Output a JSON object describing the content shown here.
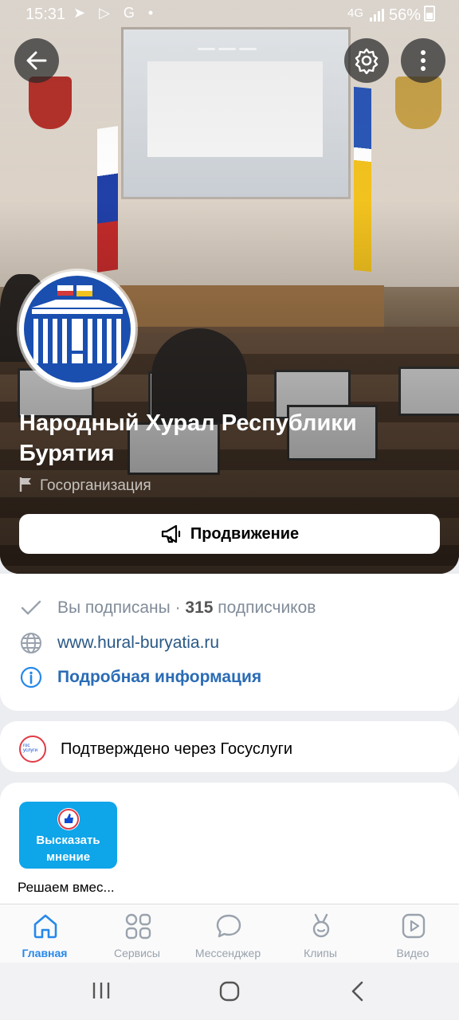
{
  "status_bar": {
    "time": "15:31",
    "left_icons": "➤ ▷ G •",
    "network": "4G",
    "battery": "56%"
  },
  "header": {
    "back_icon": "arrow-left-icon",
    "settings_icon": "gear-icon",
    "more_icon": "vertical-dots-icon"
  },
  "community": {
    "name": "Народный Хурал Республики Бурятия",
    "type": "Госорганизация",
    "promo_button": "Продвижение"
  },
  "info": {
    "subscribed_text": "Вы подписаны · ",
    "subscribers_count": "315",
    "subscribers_suffix": " подписчиков",
    "website": "www.hural-buryatia.ru",
    "details_link": "Подробная информация"
  },
  "gosuslugi": {
    "logo_text": "гос услуги",
    "text": "Подтверждено через Госуслуги"
  },
  "widget": {
    "tile_text": "Высказать мнение",
    "caption": "Решаем вмес..."
  },
  "bottom_nav": [
    {
      "label": "Главная",
      "icon": "home-icon",
      "active": true
    },
    {
      "label": "Сервисы",
      "icon": "services-grid-icon",
      "active": false
    },
    {
      "label": "Мессенджер",
      "icon": "chat-bubble-icon",
      "active": false
    },
    {
      "label": "Клипы",
      "icon": "clips-icon",
      "active": false
    },
    {
      "label": "Видео",
      "icon": "video-play-icon",
      "active": false
    }
  ],
  "colors": {
    "accent": "#2688eb",
    "link": "#2a5885",
    "muted": "#818c99",
    "gosuslugi_red": "#e23a45",
    "widget_blue": "#0ea5e9"
  }
}
